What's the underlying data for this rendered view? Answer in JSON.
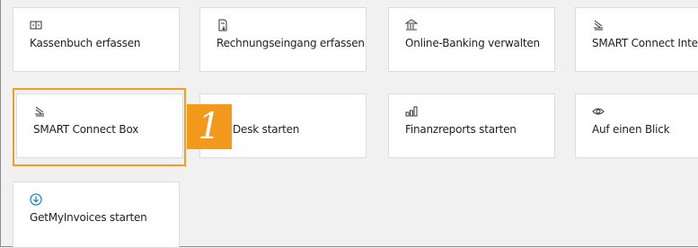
{
  "tiles": {
    "kassenbuch": {
      "label": "Kassenbuch erfassen",
      "icon": "cashbook-icon"
    },
    "rechnungseingang": {
      "label": "Rechnungseingang erfassen",
      "icon": "invoice-icon"
    },
    "online_banking": {
      "label": "Online-Banking verwalten",
      "icon": "bank-icon"
    },
    "smart_connect_integra": {
      "label": "SMART Connect Integra",
      "icon": "smart-connect-icon"
    },
    "smart_connect_box": {
      "label": "SMART Connect Box",
      "icon": "smart-connect-icon"
    },
    "desk_starten": {
      "label": "Desk starten",
      "icon": "desk-icon"
    },
    "finanzreports": {
      "label": "Finanzreports starten",
      "icon": "chart-icon"
    },
    "auf_einen_blick": {
      "label": "Auf einen Blick",
      "icon": "eye-icon"
    },
    "getmyinvoices": {
      "label": "GetMyInvoices starten",
      "icon": "download-circle-icon"
    }
  },
  "callout": {
    "number": "1"
  },
  "colors": {
    "accent": "#f0a020",
    "badge": "#f39a1c",
    "download_icon": "#1c8ad6",
    "tile_bg": "#ffffff",
    "page_bg": "#f1f1f1"
  }
}
